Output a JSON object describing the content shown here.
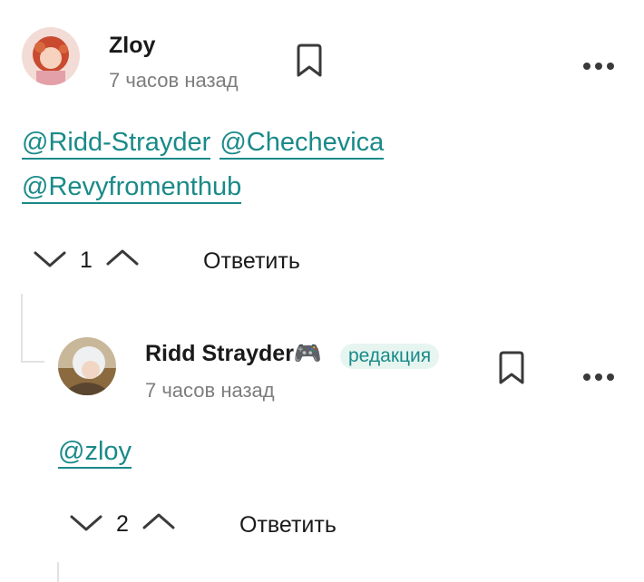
{
  "comments": [
    {
      "author": "Zloy",
      "time": "7 часов назад",
      "mentions": [
        "@Ridd-Strayder",
        "@Chechevica",
        "@Revyfromenthub"
      ],
      "score": "1",
      "reply_label": "Ответить"
    },
    {
      "author": "Ridd Strayder🎮",
      "badge": "редакция",
      "time": "7 часов назад",
      "mentions": [
        "@zloy"
      ],
      "score": "2",
      "reply_label": "Ответить"
    }
  ],
  "icons": {
    "bookmark": "bookmark-icon",
    "more": "more-icon",
    "down": "chevron-down-icon",
    "up": "chevron-up-icon"
  },
  "colors": {
    "accent": "#1a8a89",
    "badge_bg": "#e6f5f0",
    "muted": "#7d7d7d",
    "thread_line": "#e2e2e2"
  }
}
